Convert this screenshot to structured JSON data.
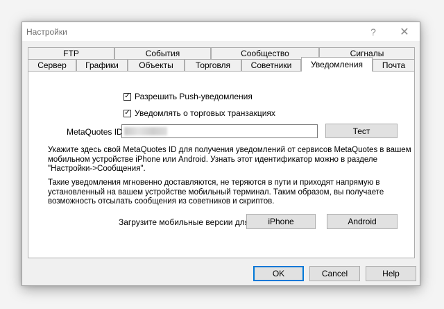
{
  "window": {
    "title": "Настройки",
    "help_symbol": "?",
    "close_symbol": "✕"
  },
  "tabs": {
    "row_back": [
      "FTP",
      "События",
      "Сообщество",
      "Сигналы"
    ],
    "row_front": [
      "Сервер",
      "Графики",
      "Объекты",
      "Торговля",
      "Советники",
      "Уведомления",
      "Почта"
    ],
    "active": "Уведомления"
  },
  "notifications": {
    "enable_push_label": "Разрешить Push-уведомления",
    "enable_push_checked": true,
    "notify_trades_label": "Уведомлять о торговых транзакциях",
    "notify_trades_checked": true,
    "metaquotes_id_label": "MetaQuotes ID:",
    "test_button": "Тест",
    "info_paragraph_1": [
      "Укажите здесь свой MetaQuotes ID для получения уведомлений от сервисов MetaQuotes в вашем",
      "мобильном устройстве iPhone или Android. Узнать этот идентификатор можно в разделе",
      "\"Настройки->Сообщения\"."
    ],
    "info_paragraph_2": [
      "Такие уведомления мгновенно доставляются, не теряются в пути и приходят напрямую в",
      "установленный на вашем устройстве мобильный терминал. Таким образом, вы получаете",
      "возможность отсылать сообщения из советников и скриптов."
    ],
    "download_label": "Загрузите мобильные версии для:",
    "iphone_button": "iPhone",
    "android_button": "Android"
  },
  "footer": {
    "ok_button": "OK",
    "cancel_button": "Cancel",
    "help_button": "Help"
  }
}
